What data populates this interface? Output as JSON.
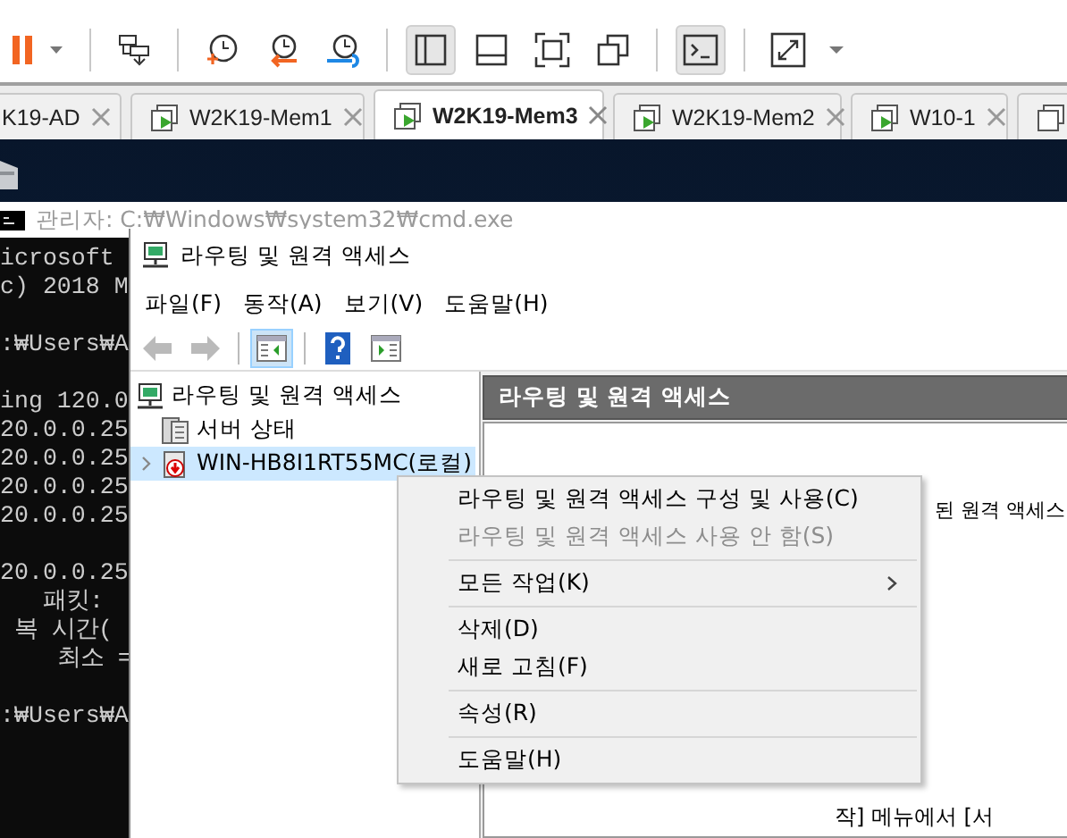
{
  "toolbar": [
    {
      "pressed": false
    },
    {
      "pressed": false
    },
    {
      "pressed": false
    },
    {
      "pressed": false
    },
    {
      "pressed": false
    },
    {
      "pressed": true
    },
    {
      "pressed": false
    },
    {
      "pressed": false
    },
    {
      "pressed": false
    },
    {
      "pressed": true
    },
    {
      "pressed": false
    }
  ],
  "tabs": [
    {
      "label": "K19-AD",
      "selected": false
    },
    {
      "label": "W2K19-Mem1",
      "selected": false
    },
    {
      "label": "W2K19-Mem3",
      "selected": true
    },
    {
      "label": "W2K19-Mem2",
      "selected": false
    },
    {
      "label": "W10-1",
      "selected": false
    },
    {
      "selected": false
    }
  ],
  "cmd": {
    "title": "관리자: C:₩Windows₩system32₩cmd.exe",
    "blocks": [
      [
        "icrosoft",
        "c) 2018 M"
      ],
      [
        ":₩Users₩A"
      ],
      [
        "ing 120.0",
        "20.0.0.25",
        "20.0.0.25",
        "20.0.0.25",
        "20.0.0.25"
      ],
      [
        "20.0.0.25",
        "   패킷:",
        " 복 시간(",
        "    최소 ="
      ],
      [
        ":₩Users₩A"
      ]
    ]
  },
  "mmc": {
    "title": "라우팅 및 원격 액세스",
    "menus": [
      "파일(F)",
      "동작(A)",
      "보기(V)",
      "도움말(H)"
    ],
    "toolbar": [
      {
        "disabled": true,
        "pressed": false
      },
      {
        "disabled": true,
        "pressed": false
      },
      {
        "disabled": false,
        "pressed": true
      },
      {
        "disabled": false,
        "pressed": false
      },
      {
        "disabled": false,
        "pressed": false
      }
    ],
    "tree": [
      {
        "label": "라우팅 및 원격 액세스",
        "selected": false,
        "children": [
          {
            "label": "서버 상태",
            "selected": false
          },
          {
            "label": "WIN-HB8I1RT55MC(로컬)",
            "selected": true,
            "expanded": false
          }
        ]
      }
    ],
    "pane_title": "라우팅 및 원격 액세스",
    "pane_lines": [
      "된 원격 액세스",
      "작] 메뉴에서 [서"
    ]
  },
  "context_menu": [
    {
      "kind": "item",
      "label": "라우팅 및 원격 액세스 구성 및 사용(C)",
      "disabled": false,
      "submenu": false
    },
    {
      "kind": "item",
      "label": "라우팅 및 원격 액세스 사용 안 함(S)",
      "disabled": true,
      "submenu": false
    },
    {
      "kind": "separator"
    },
    {
      "kind": "item",
      "label": "모든 작업(K)",
      "disabled": false,
      "submenu": true
    },
    {
      "kind": "separator"
    },
    {
      "kind": "item",
      "label": "삭제(D)",
      "disabled": false,
      "submenu": false
    },
    {
      "kind": "item",
      "label": "새로 고침(F)",
      "disabled": false,
      "submenu": false
    },
    {
      "kind": "separator"
    },
    {
      "kind": "item",
      "label": "속성(R)",
      "disabled": false,
      "submenu": false
    },
    {
      "kind": "separator"
    },
    {
      "kind": "item",
      "label": "도움말(H)",
      "disabled": false,
      "submenu": false
    }
  ]
}
